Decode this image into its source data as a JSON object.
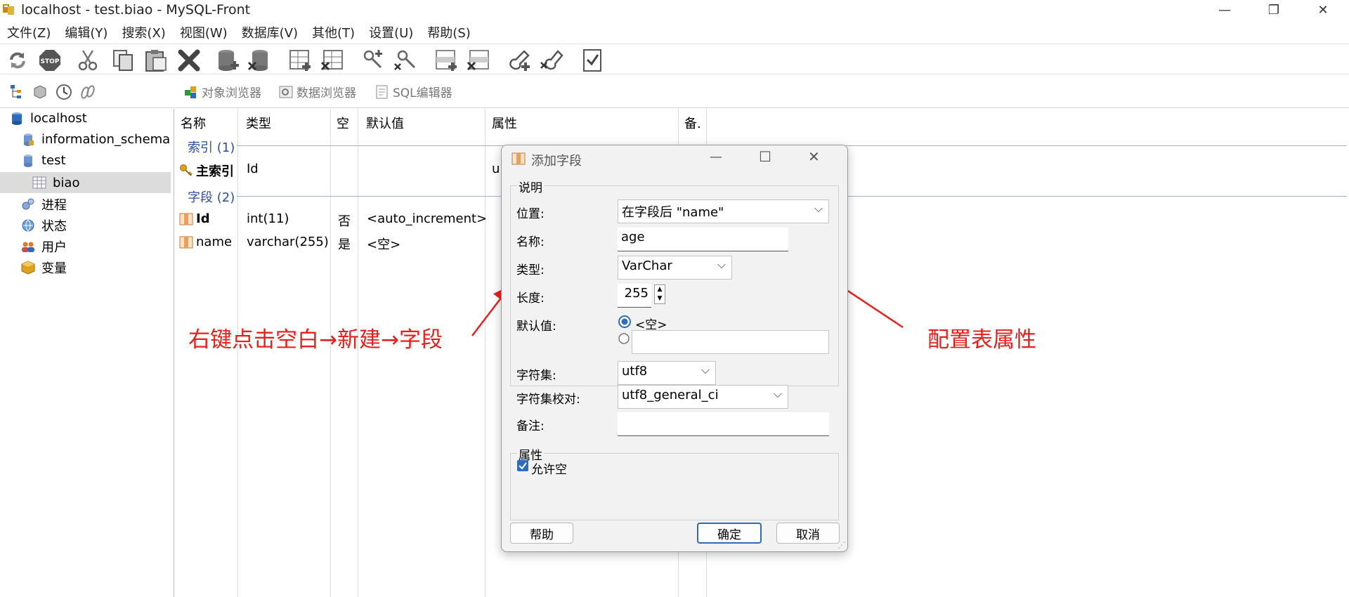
{
  "window": {
    "title": "localhost - test.biao - MySQL-Front",
    "minimize_glyph": "—",
    "maximize_glyph": "❐",
    "close_glyph": "✕"
  },
  "menu": [
    "文件(Z)",
    "编辑(Y)",
    "搜索(X)",
    "视图(W)",
    "数据库(V)",
    "其他(T)",
    "设置(U)",
    "帮助(S)"
  ],
  "toolbar_icons": [
    "refresh-icon",
    "stop-icon",
    "cut-icon",
    "copy-icon",
    "paste-icon",
    "delete-icon",
    "database-add-icon",
    "database-delete-icon",
    "table-add-icon",
    "table-delete-icon",
    "user-add-icon",
    "user-delete-icon",
    "row-add-icon",
    "row-delete-icon",
    "key-add-icon",
    "key-delete-icon",
    "checklist-icon"
  ],
  "secondbar": {
    "tabs": [
      "对象浏览器",
      "数据浏览器",
      "SQL编辑器"
    ]
  },
  "tree": {
    "items": [
      {
        "label": "localhost",
        "icon": "server-icon"
      },
      {
        "label": "information_schema",
        "icon": "database-icon"
      },
      {
        "label": "test",
        "icon": "database-icon"
      },
      {
        "label": "biao",
        "icon": "table-icon"
      },
      {
        "label": "进程",
        "icon": "process-icon"
      },
      {
        "label": "状态",
        "icon": "status-icon"
      },
      {
        "label": "用户",
        "icon": "users-icon"
      },
      {
        "label": "变量",
        "icon": "variables-icon"
      }
    ]
  },
  "grid": {
    "columns": [
      "名称",
      "类型",
      "空",
      "默认值",
      "属性",
      "备."
    ],
    "index_group": "索引 (1)",
    "index_row": {
      "name": "主索引",
      "type": "Id",
      "attr": "u"
    },
    "field_group": "字段 (2)",
    "fields": [
      {
        "name": "Id",
        "type": "int(11)",
        "null": "否",
        "default": "<auto_increment>"
      },
      {
        "name": "name",
        "type": "varchar(255)",
        "null": "是",
        "default": "<空>"
      }
    ]
  },
  "dialog": {
    "title": "添加字段",
    "section_desc": "说明",
    "position_label": "位置:",
    "position_value": "在字段后 \"name\"",
    "name_label": "名称:",
    "name_value": "age",
    "type_label": "类型:",
    "type_value": "VarChar",
    "length_label": "长度:",
    "length_value": "255",
    "default_label": "默认值:",
    "default_option_empty": "<空>",
    "default_option_custom_value": "",
    "charset_label": "字符集:",
    "charset_value": "utf8",
    "collation_label": "字符集校对:",
    "collation_value": "utf8_general_ci",
    "comment_label": "备注:",
    "comment_value": "",
    "section_attr": "属性",
    "allow_null_label": "允许空",
    "allow_null_checked": true,
    "help_button": "帮助",
    "ok_button": "确定",
    "cancel_button": "取消"
  },
  "annotations": {
    "left": "右键点击空白→新建→字段",
    "right": "配置表属性",
    "color": "#e8201d"
  }
}
